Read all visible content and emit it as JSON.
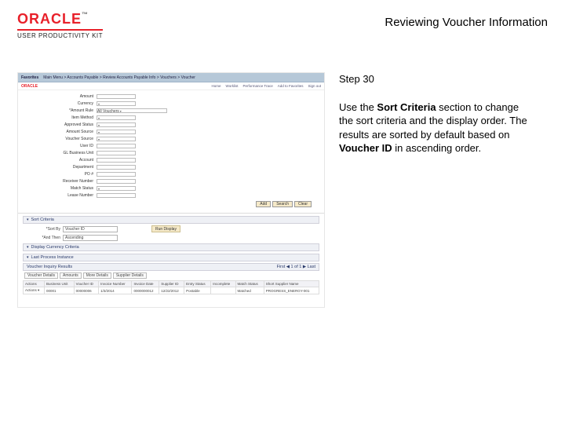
{
  "header": {
    "brand": "ORACLE",
    "tm": "™",
    "sub": "USER PRODUCTIVITY KIT",
    "title": "Reviewing Voucher Information"
  },
  "panel": {
    "step": "Step 30",
    "p1a": "Use the ",
    "p1b": "Sort Criteria",
    "p1c": " section to change the sort criteria and the display order. The results are sorted by default based on ",
    "p1d": "Voucher ID",
    "p1e": " in ascending order."
  },
  "ss": {
    "banner": {
      "a": "Favorites",
      "b": "Main Menu  >  Accounts Payable  >  Review Accounts Payable Info  >  Vouchers  >  Voucher"
    },
    "brand": "ORACLE",
    "nav": [
      "Home",
      "Worklist",
      "Performance Trace",
      "Add to Favorites",
      "Sign out"
    ],
    "form": {
      "f1": "Amount",
      "f2": "Currency",
      "f3": "*Amount Rule",
      "f4": "Item Method",
      "f5": "Approved Status",
      "f6": "Amount Source",
      "f7": "Voucher Source",
      "f8": "User ID",
      "f9": "GL Business Unit",
      "f10": "Account",
      "f11": "Department",
      "f12": "PO #",
      "f13": "Receiver Number",
      "f14": "Match Status",
      "f15": "Lease Number",
      "v1": "All Vouchers",
      "btn_add": "Add",
      "btn_search": "Search",
      "btn_clear": "Clear"
    },
    "sort": {
      "section_label": "Sort Criteria",
      "sortby_lbl": "*Sort By",
      "sortby_val": "Voucher ID",
      "andthen_lbl": "*And Then",
      "andthen_val": "Ascending",
      "rundisplay": "Run Display"
    },
    "sec2": "Display Currency Criteria",
    "sec3": "Last Process Instance",
    "grid": {
      "title": "Voucher Inquiry Results",
      "pager": "First  ◀  1 of 1  ▶  Last",
      "tabs": [
        "Voucher Details",
        "Amounts",
        "More Details",
        "Supplier Details"
      ],
      "cols": [
        "Actions",
        "Business Unit",
        "Voucher ID",
        "Invoice Number",
        "Invoice Date",
        "Supplier ID",
        "Entry Status",
        "Incomplete",
        "Match Status",
        "Short Supplier Name"
      ],
      "row": [
        "Actions ▾",
        "00001",
        "00000006",
        "1/3/2014",
        "0000000012",
        "12/22/2012",
        "Postable",
        "",
        "Matched",
        "PROGRESS_ENERGY-001"
      ]
    }
  }
}
